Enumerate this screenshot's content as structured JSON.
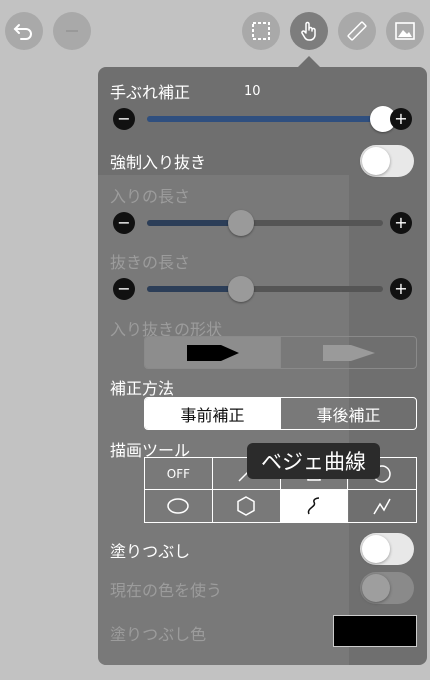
{
  "toolbar": {
    "buttons": [
      {
        "icon": "undo-icon"
      },
      {
        "icon": "blank-icon"
      },
      {
        "icon": "selection-icon"
      },
      {
        "icon": "hand-touch-icon"
      },
      {
        "icon": "ruler-icon"
      },
      {
        "icon": "image-icon"
      }
    ]
  },
  "stabilizer": {
    "label": "手ぶれ補正",
    "value": "10",
    "fraction": 1.0
  },
  "taper": {
    "label": "強制入り抜き",
    "in_length": {
      "label": "入りの長さ",
      "fraction": 0.4
    },
    "out_length": {
      "label": "抜きの長さ",
      "fraction": 0.4
    },
    "shape": {
      "label": "入り抜きの形状"
    }
  },
  "correction": {
    "label": "補正方法",
    "options": [
      "事前補正",
      "事後補正"
    ],
    "selected": 0
  },
  "draw_tool": {
    "label": "描画ツール",
    "off_label": "OFF",
    "tooltip": "ベジェ曲線",
    "tools": [
      "off",
      "line",
      "rectangle",
      "circle",
      "ellipse",
      "polygon",
      "bezier",
      "polyline"
    ],
    "selected": "bezier"
  },
  "fill": {
    "label": "塗りつぶし",
    "use_current": "現在の色を使う",
    "color_label": "塗りつぶし色",
    "color": "#000000"
  },
  "colors": {
    "accent": "#2f4f7f",
    "panel": "#6f6f6f",
    "background": "#c2c2c2"
  }
}
